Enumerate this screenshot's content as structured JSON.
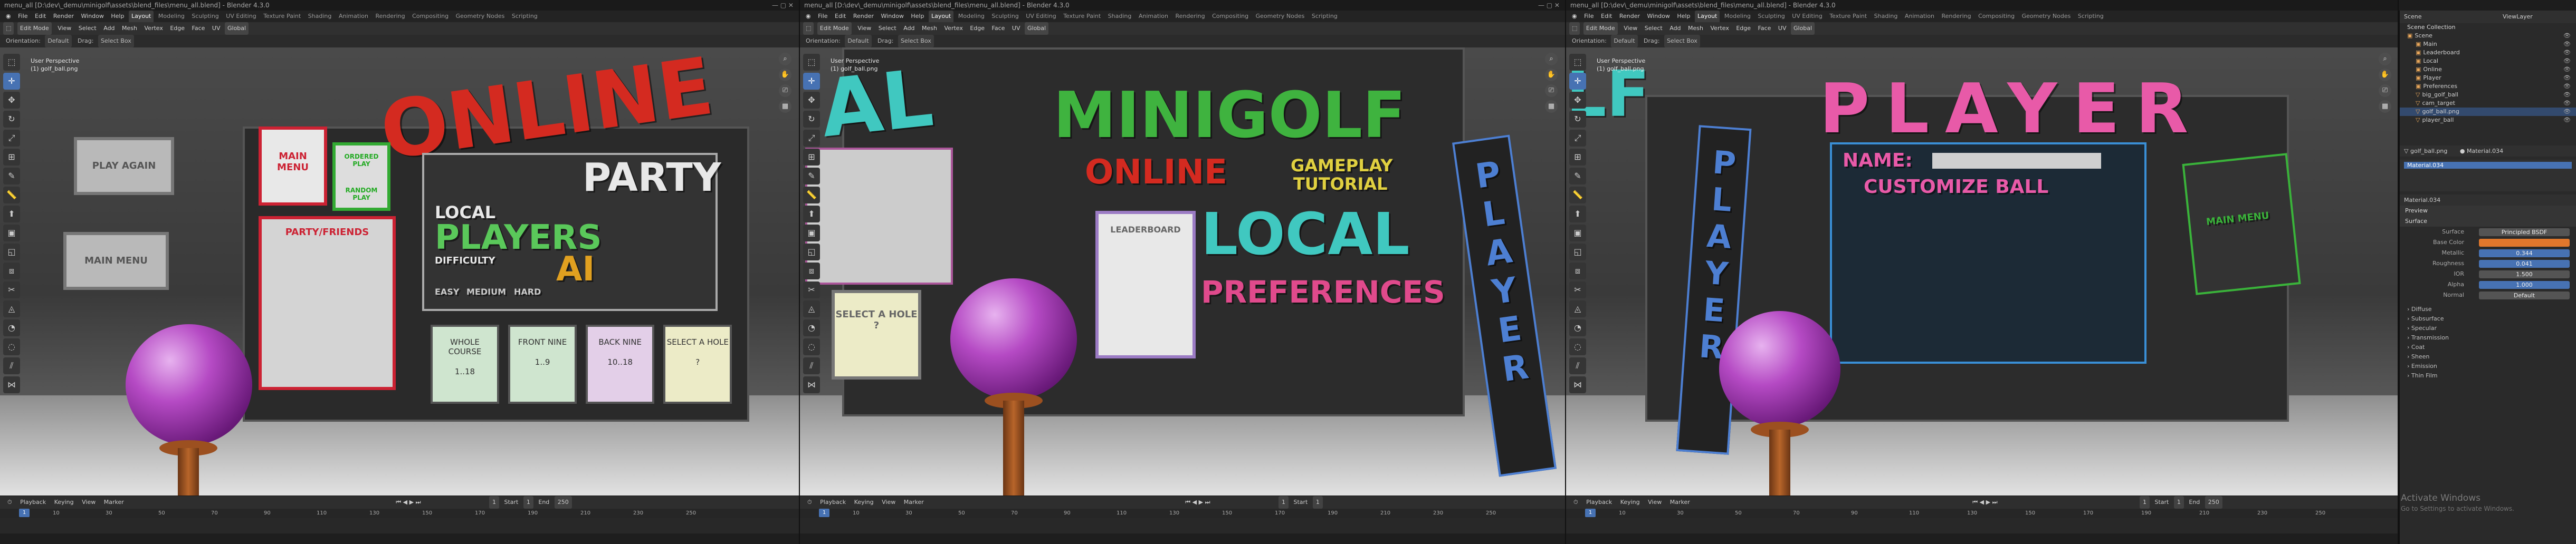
{
  "windows": [
    {
      "title": "menu_all [D:\\dev\\_demu\\minigolf\\assets\\blend_files\\menu_all.blend] - Blender 4.3.0",
      "menus": [
        "File",
        "Edit",
        "Render",
        "Window",
        "Help"
      ],
      "tabs": [
        "Layout",
        "Modeling",
        "Sculpting",
        "UV Editing",
        "Texture Paint",
        "Shading",
        "Animation",
        "Rendering",
        "Compositing",
        "Geometry Nodes",
        "Scripting"
      ],
      "active_tab": "Layout",
      "mode": "Edit Mode",
      "header_items": [
        "View",
        "Select",
        "Add",
        "Mesh",
        "Vertex",
        "Edge",
        "Face",
        "UV"
      ],
      "transform": "Global",
      "orientation_label": "Orientation:",
      "orientation_value": "Default",
      "drag_label": "Drag:",
      "drag_value": "Select Box",
      "vp_line1": "User Perspective",
      "vp_line2": "(1) golf_ball.png",
      "scene_text": {
        "title": "ONLINE",
        "play_again": "PLAY AGAIN",
        "main_menu_small": "MAIN MENU",
        "main_menu_card": "MAIN MENU",
        "ordered_play": "ORDERED PLAY",
        "random_play": "RANDOM PLAY",
        "party": "PARTY",
        "local": "LOCAL",
        "players": "PLAYERS",
        "difficulty": "DIFFICULTY",
        "ai": "AI",
        "easy": "EASY",
        "medium": "MEDIUM",
        "hard": "HARD",
        "party_friends": "PARTY/FRIENDS",
        "holes": [
          {
            "name": "WHOLE COURSE",
            "range": "1..18"
          },
          {
            "name": "FRONT NINE",
            "range": "1..9"
          },
          {
            "name": "BACK NINE",
            "range": "10..18"
          },
          {
            "name": "SELECT A HOLE",
            "range": "?"
          }
        ]
      }
    },
    {
      "title": "menu_all [D:\\dev\\_demu\\minigolf\\assets\\blend_files\\menu_all.blend] - Blender 4.3.0",
      "menus": [
        "File",
        "Edit",
        "Render",
        "Window",
        "Help"
      ],
      "tabs": [
        "Layout",
        "Modeling",
        "Sculpting",
        "UV Editing",
        "Texture Paint",
        "Shading",
        "Animation",
        "Rendering",
        "Compositing",
        "Geometry Nodes",
        "Scripting"
      ],
      "active_tab": "Layout",
      "mode": "Edit Mode",
      "header_items": [
        "View",
        "Select",
        "Add",
        "Mesh",
        "Vertex",
        "Edge",
        "Face",
        "UV"
      ],
      "transform": "Global",
      "orientation_label": "Orientation:",
      "orientation_value": "Default",
      "drag_label": "Drag:",
      "drag_value": "Select Box",
      "vp_line1": "User Perspective",
      "vp_line2": "(1) golf_ball.png",
      "scene_text": {
        "title_left": "AL",
        "minigolf": "MINIGOLF",
        "online": "ONLINE",
        "gameplay": "GAMEPLAY",
        "tutorial": "TUTORIAL",
        "local": "LOCAL",
        "preferences": "PREFERENCES",
        "leaderboard": "LEADERBOARD",
        "select_hole": "SELECT A HOLE",
        "select_hole_range": "?",
        "player_vertical": "PLAYER"
      }
    },
    {
      "title": "menu_all [D:\\dev\\_demu\\minigolf\\assets\\blend_files\\menu_all.blend] - Blender 4.3.0",
      "menus": [
        "File",
        "Edit",
        "Render",
        "Window",
        "Help"
      ],
      "tabs": [
        "Layout",
        "Modeling",
        "Sculpting",
        "UV Editing",
        "Texture Paint",
        "Shading",
        "Animation",
        "Rendering",
        "Compositing",
        "Geometry Nodes",
        "Scripting"
      ],
      "active_tab": "Layout",
      "mode": "Edit Mode",
      "header_items": [
        "View",
        "Select",
        "Add",
        "Mesh",
        "Vertex",
        "Edge",
        "Face",
        "UV"
      ],
      "transform": "Global",
      "orientation_label": "Orientation:",
      "orientation_value": "Default",
      "drag_label": "Drag:",
      "drag_value": "Select Box",
      "vp_line1": "User Perspective",
      "vp_line2": "(1) golf_ball.png",
      "scene_text": {
        "player": "PLAYER",
        "name_label": "NAME:",
        "customize_ball": "CUSTOMIZE BALL",
        "main_menu": "MAIN MENU",
        "player_vertical": "PLAYER",
        "left_fragment": "LF"
      }
    }
  ],
  "timeline": {
    "playback": "Playback",
    "keying": "Keying",
    "view": "View",
    "marker": "Marker",
    "current_frame": "1",
    "start_label": "Start",
    "start": "1",
    "end_label": "End",
    "end": "250",
    "ticks": [
      "1",
      "10",
      "20",
      "30",
      "40",
      "50",
      "60",
      "70",
      "80",
      "90",
      "100",
      "110",
      "120",
      "130",
      "140",
      "150",
      "160",
      "170",
      "180",
      "190",
      "200",
      "210",
      "220",
      "230",
      "240",
      "250"
    ]
  },
  "properties": {
    "scene_label": "Scene",
    "view_layer": "ViewLayer",
    "collection_title": "Scene Collection",
    "outliner": [
      {
        "name": "Scene",
        "level": 0
      },
      {
        "name": "Main",
        "level": 1
      },
      {
        "name": "Leaderboard",
        "level": 1
      },
      {
        "name": "Local",
        "level": 1
      },
      {
        "name": "Online",
        "level": 1
      },
      {
        "name": "Player",
        "level": 1
      },
      {
        "name": "Preferences",
        "level": 1
      },
      {
        "name": "big_golf_ball",
        "level": 1
      },
      {
        "name": "cam_target",
        "level": 1
      },
      {
        "name": "golf_ball.png",
        "level": 1
      },
      {
        "name": "player_ball",
        "level": 1
      }
    ],
    "object": "golf_ball.png",
    "material_slot": "Material.034",
    "material": "Material.034",
    "preview": "Preview",
    "surface_section": "Surface",
    "surface_label": "Surface",
    "surface_value": "Principled BSDF",
    "rows": [
      {
        "label": "Base Color",
        "value": "",
        "style": "orange"
      },
      {
        "label": "Metallic",
        "value": "0.344",
        "style": "blue"
      },
      {
        "label": "Roughness",
        "value": "0.041",
        "style": "blue"
      },
      {
        "label": "IOR",
        "value": "1.500",
        "style": "plain"
      },
      {
        "label": "Alpha",
        "value": "1.000",
        "style": "blue"
      },
      {
        "label": "Normal",
        "value": "Default",
        "style": "plain"
      }
    ],
    "collapsed": [
      "Diffuse",
      "Subsurface",
      "Specular",
      "Transmission",
      "Coat",
      "Sheen",
      "Emission",
      "Thin Film"
    ],
    "activate_title": "Activate Windows",
    "activate_sub": "Go to Settings to activate Windows."
  },
  "colors": {
    "accent": "#4772b3",
    "online_red": "#d42a20",
    "minigolf_green": "#3fb33f",
    "local_teal": "#40c8c0",
    "player_pink": "#e85aa8",
    "preferences_pink": "#e04a8c",
    "ball_purple": "#b54ac4"
  }
}
